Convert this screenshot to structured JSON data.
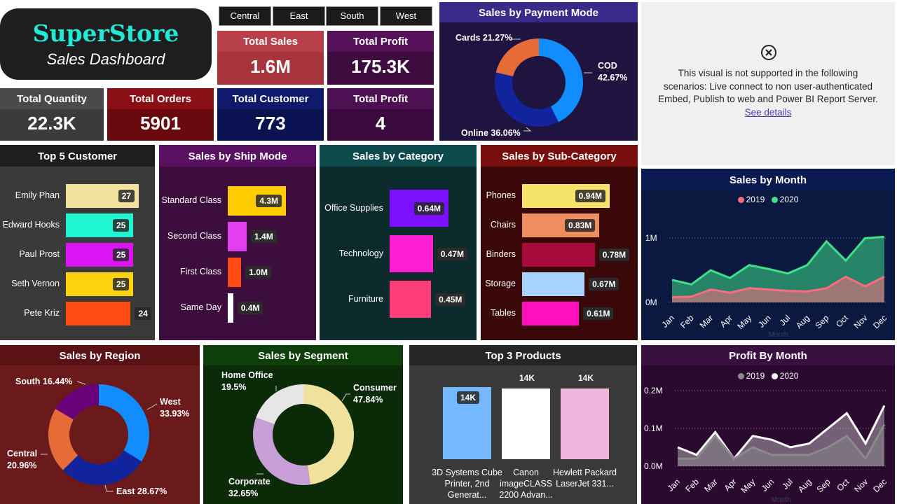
{
  "brand": {
    "title": "SuperStore",
    "subtitle": "Sales Dashboard"
  },
  "region_filters": [
    "Central",
    "East",
    "South",
    "West"
  ],
  "kpis": {
    "total_sales": {
      "label": "Total Sales",
      "value": "1.6M"
    },
    "total_profit_top": {
      "label": "Total Profit",
      "value": "175.3K"
    },
    "total_quantity": {
      "label": "Total Quantity",
      "value": "22.3K"
    },
    "total_orders": {
      "label": "Total Orders",
      "value": "5901"
    },
    "total_customer": {
      "label": "Total Customer",
      "value": "773"
    },
    "total_profit_bottom": {
      "label": "Total Profit",
      "value": "4"
    }
  },
  "unsupported_visual": {
    "message": "This visual is not supported in the following scenarios: Live connect to non user-authenticated Embed, Publish to web and Power BI Report Server.",
    "link": "See details"
  },
  "colors": {
    "page_bg": "#ffffff",
    "brand_bg": "#1e1e1e",
    "brand_title": "#22e8d6"
  },
  "chart_data": [
    {
      "id": "payment_mode",
      "type": "pie",
      "title": "Sales by Payment Mode",
      "categories": [
        "COD",
        "Online",
        "Cards"
      ],
      "values": [
        42.67,
        36.06,
        21.27
      ],
      "labels": [
        "COD 42.67%",
        "Online 36.06%",
        "Cards 21.27%"
      ],
      "colors": [
        "#118dff",
        "#12239e",
        "#e66c37"
      ]
    },
    {
      "id": "top_customers",
      "type": "bar",
      "title": "Top 5 Customer",
      "categories": [
        "Emily Phan",
        "Edward Hooks",
        "Paul Prost",
        "Seth Vernon",
        "Pete Kriz"
      ],
      "values": [
        27,
        25,
        25,
        25,
        24
      ],
      "labels": [
        "27",
        "25",
        "25",
        "25",
        "24"
      ],
      "colors": [
        "#f2e3a1",
        "#1ff5d1",
        "#dc14f5",
        "#ffd20f",
        "#ff4a14"
      ]
    },
    {
      "id": "ship_mode",
      "type": "bar",
      "title": "Sales by Ship Mode",
      "categories": [
        "Standard Class",
        "Second Class",
        "First Class",
        "Same Day"
      ],
      "values": [
        4.3,
        1.4,
        1.0,
        0.4
      ],
      "labels": [
        "4.3M",
        "1.4M",
        "1.0M",
        "0.4M"
      ],
      "colors": [
        "#ffcc00",
        "#e23ff0",
        "#ff4a14",
        "#ffffff"
      ]
    },
    {
      "id": "category",
      "type": "bar",
      "title": "Sales by Category",
      "categories": [
        "Office Supplies",
        "Technology",
        "Furniture"
      ],
      "values": [
        0.64,
        0.47,
        0.45
      ],
      "labels": [
        "0.64M",
        "0.47M",
        "0.45M"
      ],
      "colors": [
        "#7b10ff",
        "#ff1ed2",
        "#ff3d7a"
      ]
    },
    {
      "id": "sub_category",
      "type": "bar",
      "title": "Sales by Sub-Category",
      "categories": [
        "Phones",
        "Chairs",
        "Binders",
        "Storage",
        "Tables"
      ],
      "values": [
        0.94,
        0.83,
        0.78,
        0.67,
        0.61
      ],
      "labels": [
        "0.94M",
        "0.83M",
        "0.78M",
        "0.67M",
        "0.61M"
      ],
      "colors": [
        "#f5e36a",
        "#ee8d5f",
        "#a80c3c",
        "#a9d3ff",
        "#ff10bf"
      ]
    },
    {
      "id": "sales_by_month",
      "type": "area",
      "title": "Sales by Month",
      "categories": [
        "Jan",
        "Feb",
        "Mar",
        "Apr",
        "May",
        "Jun",
        "Jul",
        "Aug",
        "Sep",
        "Oct",
        "Nov",
        "Dec"
      ],
      "xlabel": "Month",
      "y_ticks": [
        "0M",
        "1M"
      ],
      "ylim": [
        0,
        1.1
      ],
      "series": [
        {
          "name": "2019",
          "color": "#ff6b81",
          "values": [
            0.08,
            0.09,
            0.2,
            0.15,
            0.22,
            0.2,
            0.18,
            0.17,
            0.22,
            0.4,
            0.25,
            0.4
          ]
        },
        {
          "name": "2020",
          "color": "#3ee089",
          "values": [
            0.35,
            0.28,
            0.5,
            0.38,
            0.58,
            0.52,
            0.45,
            0.58,
            0.95,
            0.65,
            1.0,
            1.02
          ]
        }
      ]
    },
    {
      "id": "region",
      "type": "pie",
      "title": "Sales by Region",
      "categories": [
        "West",
        "East",
        "Central",
        "South"
      ],
      "values": [
        33.93,
        28.67,
        20.96,
        16.44
      ],
      "labels": [
        "West 33.93%",
        "East 28.67%",
        "Central 20.96%",
        "South 16.44%"
      ],
      "colors": [
        "#118dff",
        "#12239e",
        "#e66c37",
        "#6b007b"
      ]
    },
    {
      "id": "segment",
      "type": "pie",
      "title": "Sales by Segment",
      "categories": [
        "Consumer",
        "Corporate",
        "Home Office"
      ],
      "values": [
        47.84,
        32.65,
        19.5
      ],
      "labels": [
        "Consumer 47.84%",
        "Corporate 32.65%",
        "Home Office 19.5%"
      ],
      "colors": [
        "#f0e29c",
        "#c79fd6",
        "#e6e6e6"
      ]
    },
    {
      "id": "top_products",
      "type": "bar",
      "title": "Top 3 Products",
      "categories": [
        "3D Systems Cube Printer, 2nd Generat...",
        "Canon imageCLASS 2200 Advan...",
        "Hewlett Packard LaserJet 331..."
      ],
      "values": [
        14,
        14,
        14
      ],
      "labels": [
        "14K",
        "14K",
        "14K"
      ],
      "colors": [
        "#74b8ff",
        "#ffffff",
        "#f2b5df"
      ]
    },
    {
      "id": "profit_by_month",
      "type": "area",
      "title": "Profit By Month",
      "categories": [
        "Jan",
        "Feb",
        "Mar",
        "Apr",
        "May",
        "Jun",
        "Jul",
        "Aug",
        "Sep",
        "Oct",
        "Nov",
        "Dec"
      ],
      "xlabel": "Month",
      "y_ticks": [
        "0.0M",
        "0.1M",
        "0.2M"
      ],
      "ylim": [
        0,
        0.22
      ],
      "series": [
        {
          "name": "2019",
          "color": "#8a8a8a",
          "values": [
            0.02,
            0.02,
            0.08,
            0.02,
            0.05,
            0.03,
            0.03,
            0.03,
            0.05,
            0.08,
            0.02,
            0.11
          ]
        },
        {
          "name": "2020",
          "color": "#ffffff",
          "values": [
            0.05,
            0.03,
            0.09,
            0.02,
            0.08,
            0.07,
            0.05,
            0.06,
            0.1,
            0.14,
            0.06,
            0.16
          ]
        }
      ]
    }
  ]
}
